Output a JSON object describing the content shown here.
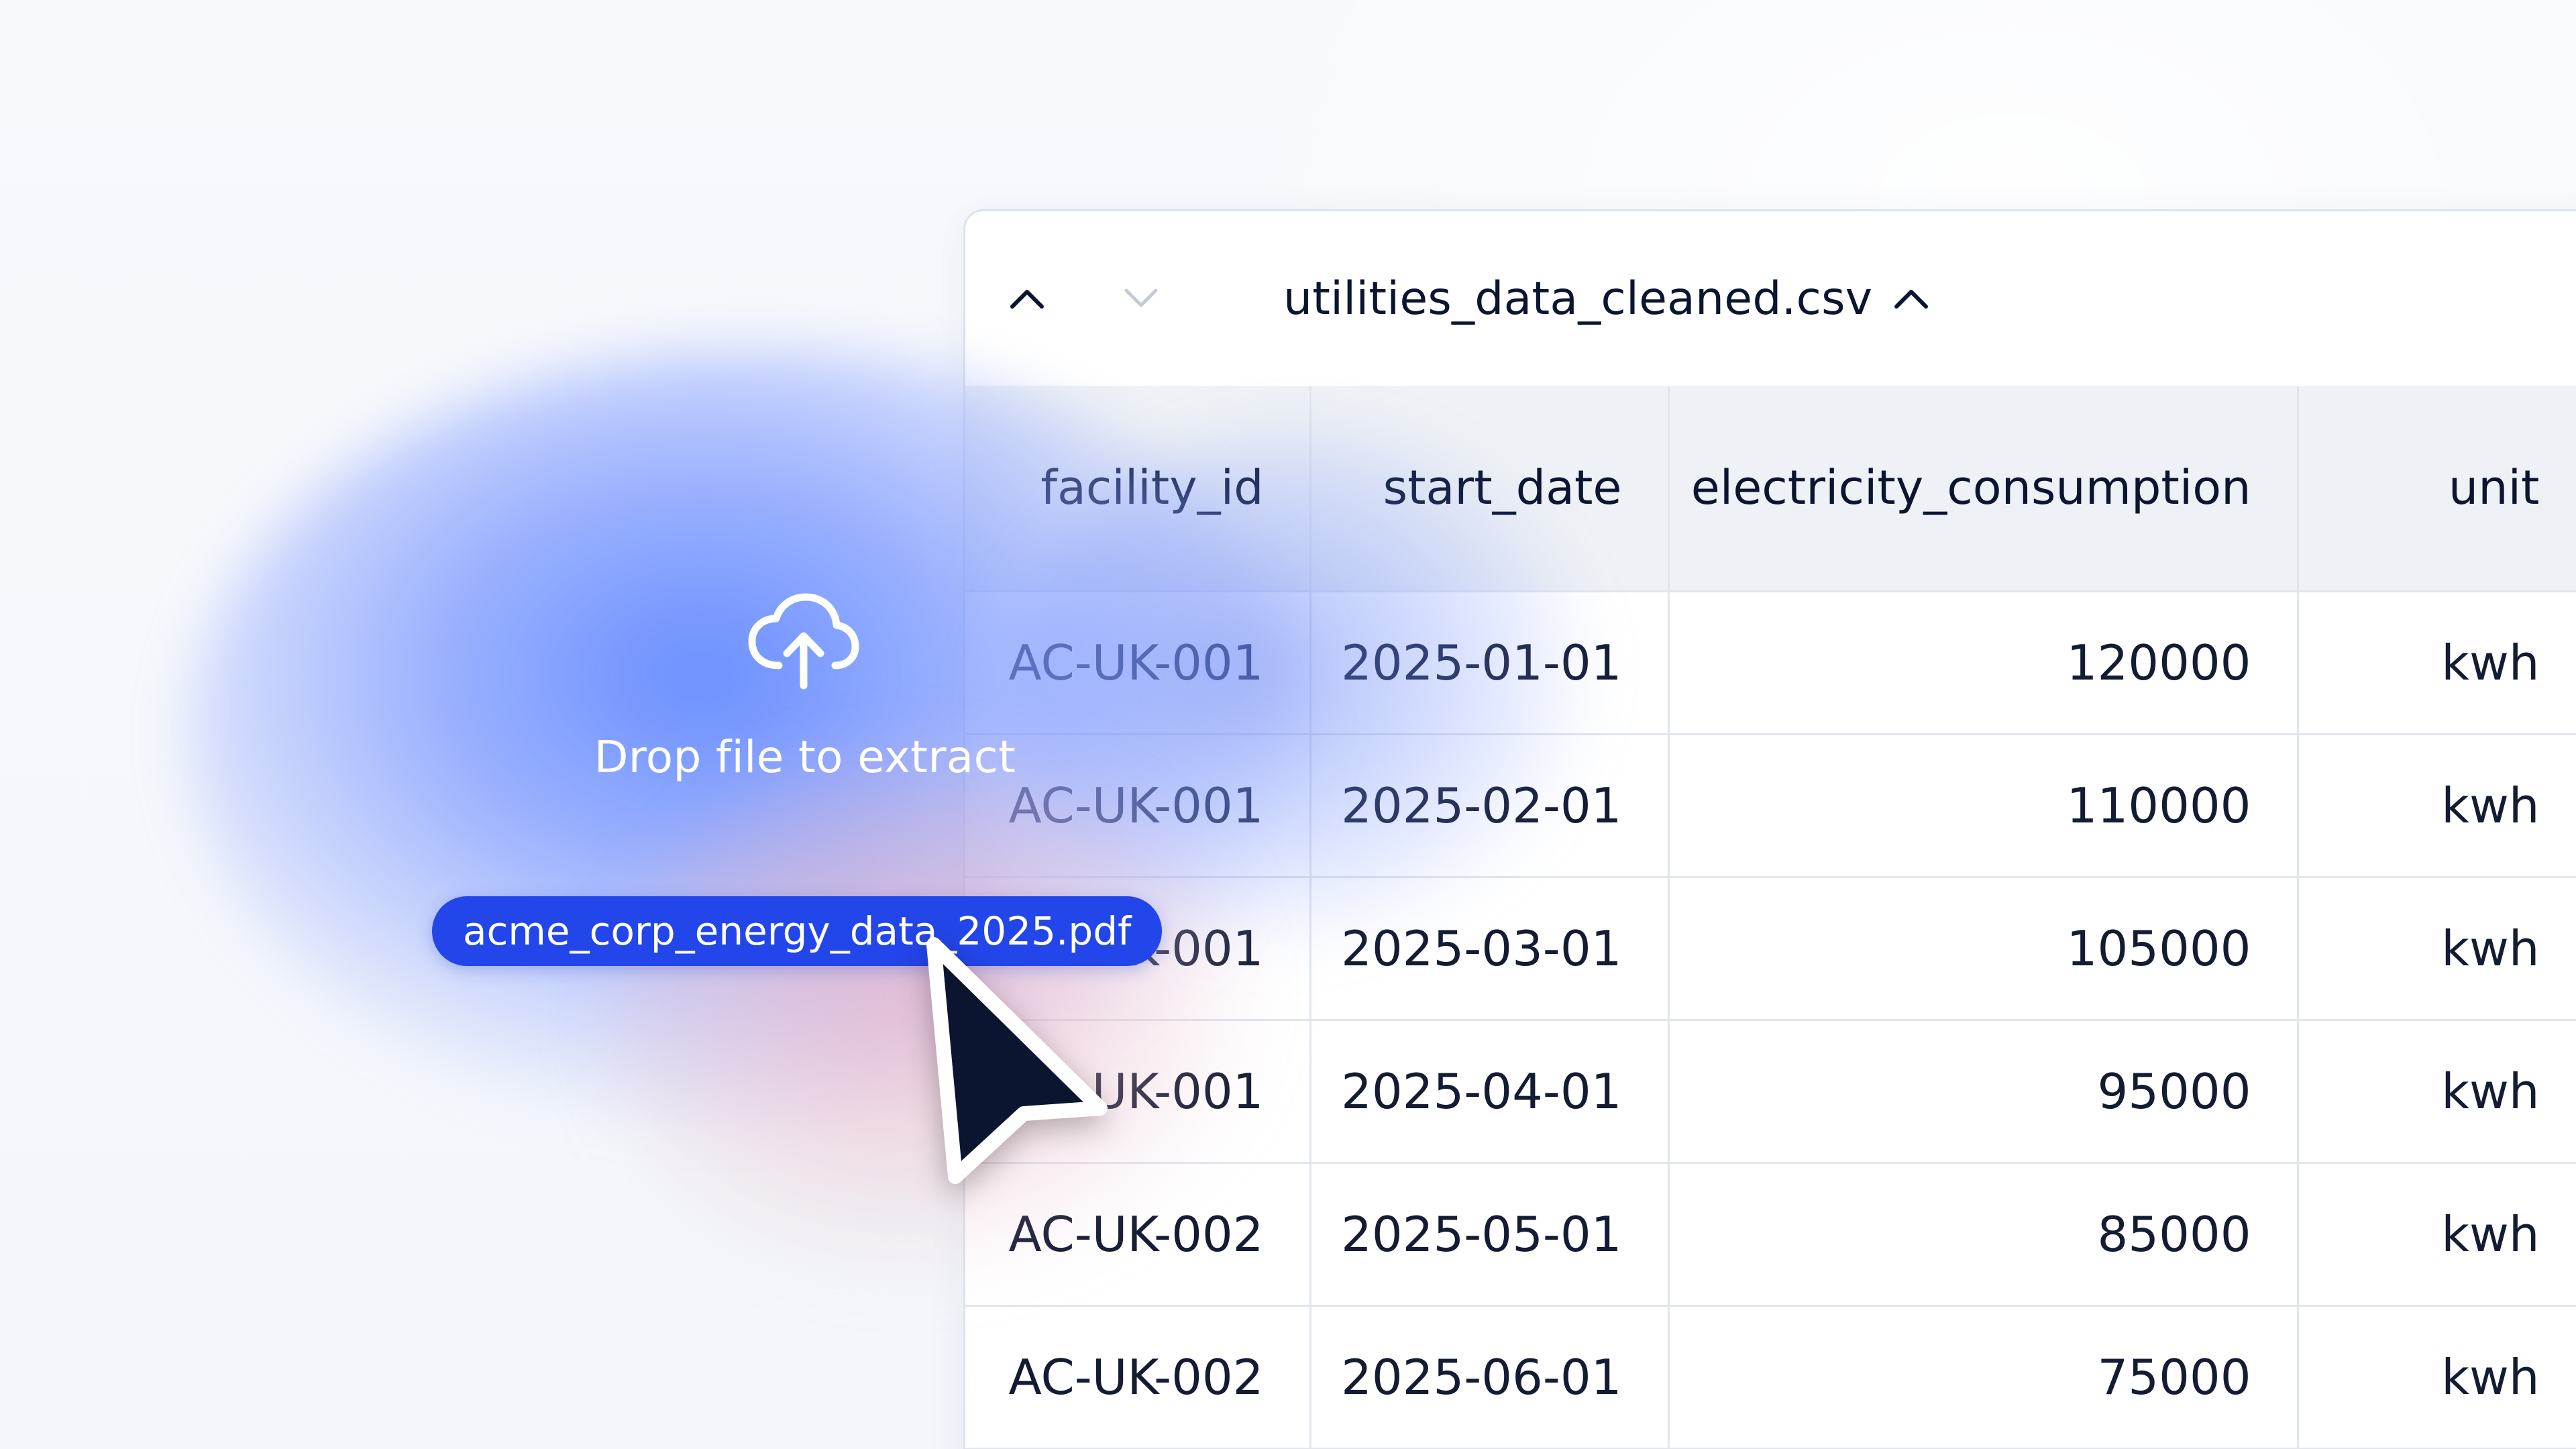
{
  "panel": {
    "file_name": "utilities_data_cleaned.csv",
    "prev_icon": "chevron-up-icon",
    "next_icon": "chevron-down-icon",
    "title_icon": "chevron-up-icon"
  },
  "table": {
    "columns": [
      "facility_id",
      "start_date",
      "electricity_consumption",
      "unit"
    ],
    "rows": [
      [
        "AC-UK-001",
        "2025-01-01",
        "120000",
        "kwh"
      ],
      [
        "AC-UK-001",
        "2025-02-01",
        "110000",
        "kwh"
      ],
      [
        "AC-UK-001",
        "2025-03-01",
        "105000",
        "kwh"
      ],
      [
        "AC-UK-001",
        "2025-04-01",
        "95000",
        "kwh"
      ],
      [
        "AC-UK-002",
        "2025-05-01",
        "85000",
        "kwh"
      ],
      [
        "AC-UK-002",
        "2025-06-01",
        "75000",
        "kwh"
      ]
    ]
  },
  "drop_zone": {
    "icon": "cloud-upload-icon",
    "label": "Drop file to extract"
  },
  "dragged_file": {
    "name": "acme_corp_energy_data_2025.pdf"
  },
  "colors": {
    "accent": "#2346ea",
    "cursor": "#0b1530"
  }
}
